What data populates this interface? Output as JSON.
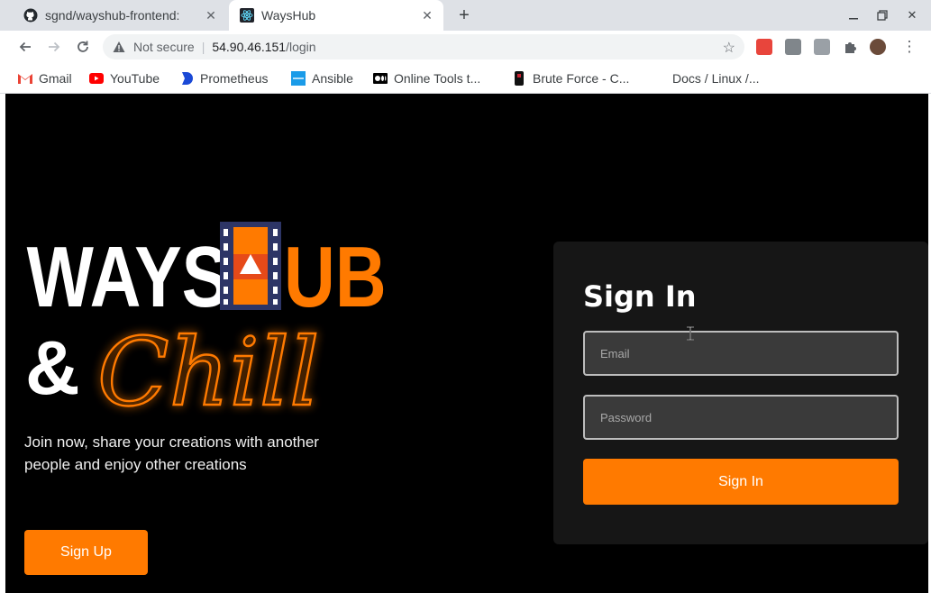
{
  "tabs": [
    {
      "title": "sgnd/wayshub-frontend: ",
      "icon": "github-icon"
    },
    {
      "title": "WaysHub",
      "icon": "react-icon"
    }
  ],
  "toolbar": {
    "security_label": "Not secure",
    "url_host": "54.90.46.151",
    "url_path": "/login"
  },
  "bookmarks": [
    {
      "label": "Gmail",
      "icon": "gmail-icon"
    },
    {
      "label": "YouTube",
      "icon": "youtube-icon"
    },
    {
      "label": "Prometheus",
      "icon": "prometheus-icon"
    },
    {
      "label": "Ansible",
      "icon": "ansible-icon"
    },
    {
      "label": "Online Tools t...",
      "icon": "medium-icon"
    },
    {
      "label": "Brute Force - C...",
      "icon": "bookmark-icon"
    },
    {
      "label": "Docs / Linux /...",
      "icon": ""
    }
  ],
  "hero": {
    "logo_word1": "WAYS",
    "logo_word2": "UB",
    "logo_amp": "&",
    "logo_script": "Chill",
    "tagline": "Join now, share your creations with another people and enjoy other creations",
    "signup_label": "Sign Up"
  },
  "signin": {
    "title": "Sign In",
    "email_placeholder": "Email",
    "password_placeholder": "Password",
    "button_label": "Sign In"
  },
  "colors": {
    "accent": "#ff7a00",
    "card_bg": "#161616",
    "page_bg": "#000000"
  }
}
